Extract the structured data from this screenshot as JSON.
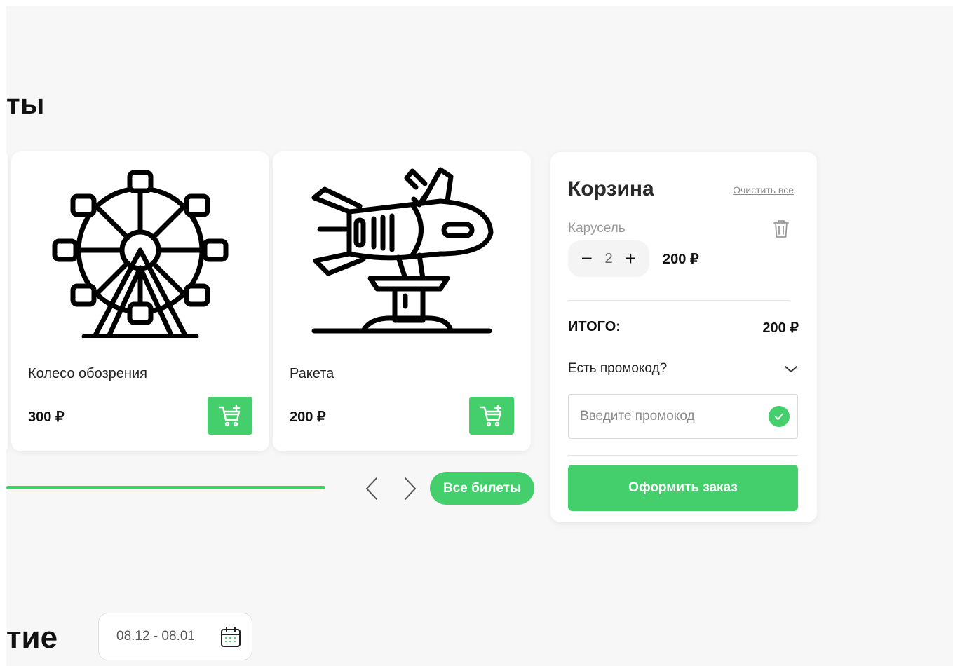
{
  "tickets_section": {
    "title_fragment": "ты"
  },
  "events_section": {
    "title_fragment": "тие"
  },
  "products": [
    {
      "name": "Колесо обозрения",
      "price": "300 ₽",
      "icon": "ferris-wheel-icon"
    },
    {
      "name": "Ракета",
      "price": "200 ₽",
      "icon": "rocket-ride-icon"
    }
  ],
  "slider": {
    "progress": 0.46,
    "all_tickets_label": "Все билеты"
  },
  "basket": {
    "title": "Корзина",
    "clear_all": "Очистить все",
    "items": [
      {
        "name": "Карусель",
        "qty": "2",
        "price": "200 ₽"
      }
    ],
    "total_label": "ИТОГО:",
    "total_value": "200 ₽",
    "promo_question": "Есть промокод?",
    "promo_placeholder": "Введите промокод",
    "order_label": "Оформить заказ"
  },
  "date_filter": {
    "range": "08.12 - 08.01"
  },
  "colors": {
    "accent": "#44cf6c",
    "background": "#f7f7f7",
    "card": "#ffffff"
  }
}
